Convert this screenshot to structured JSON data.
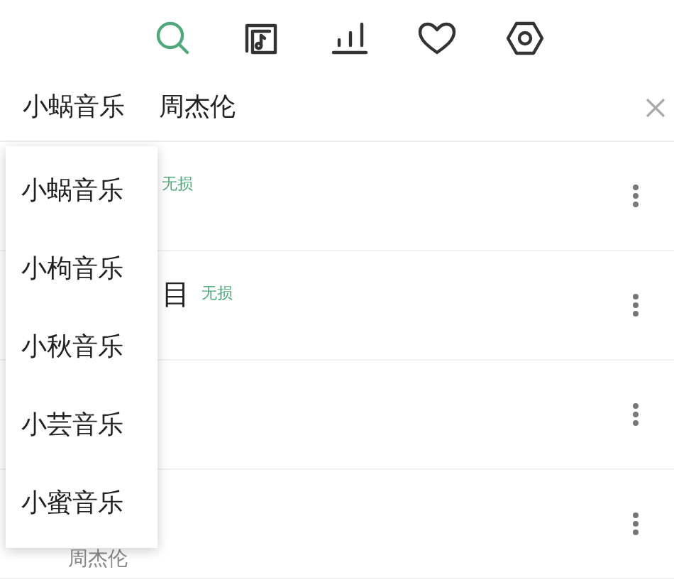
{
  "nav_tabs": [
    {
      "kind": "search",
      "selected": true
    },
    {
      "kind": "music-file",
      "selected": false
    },
    {
      "kind": "chart",
      "selected": false
    },
    {
      "kind": "heart",
      "selected": false
    },
    {
      "kind": "settings",
      "selected": false
    }
  ],
  "search": {
    "source": "小蜗音乐",
    "query": "周杰伦"
  },
  "results": [
    {
      "kind": "song",
      "badge": "无损"
    },
    {
      "kind": "song",
      "title": "目",
      "badge": "无损"
    },
    {
      "kind": "song"
    },
    {
      "kind": "song",
      "artist": "周杰伦"
    }
  ],
  "source_menu": [
    "小蜗音乐",
    "小枸音乐",
    "小秋音乐",
    "小芸音乐",
    "小蜜音乐"
  ]
}
